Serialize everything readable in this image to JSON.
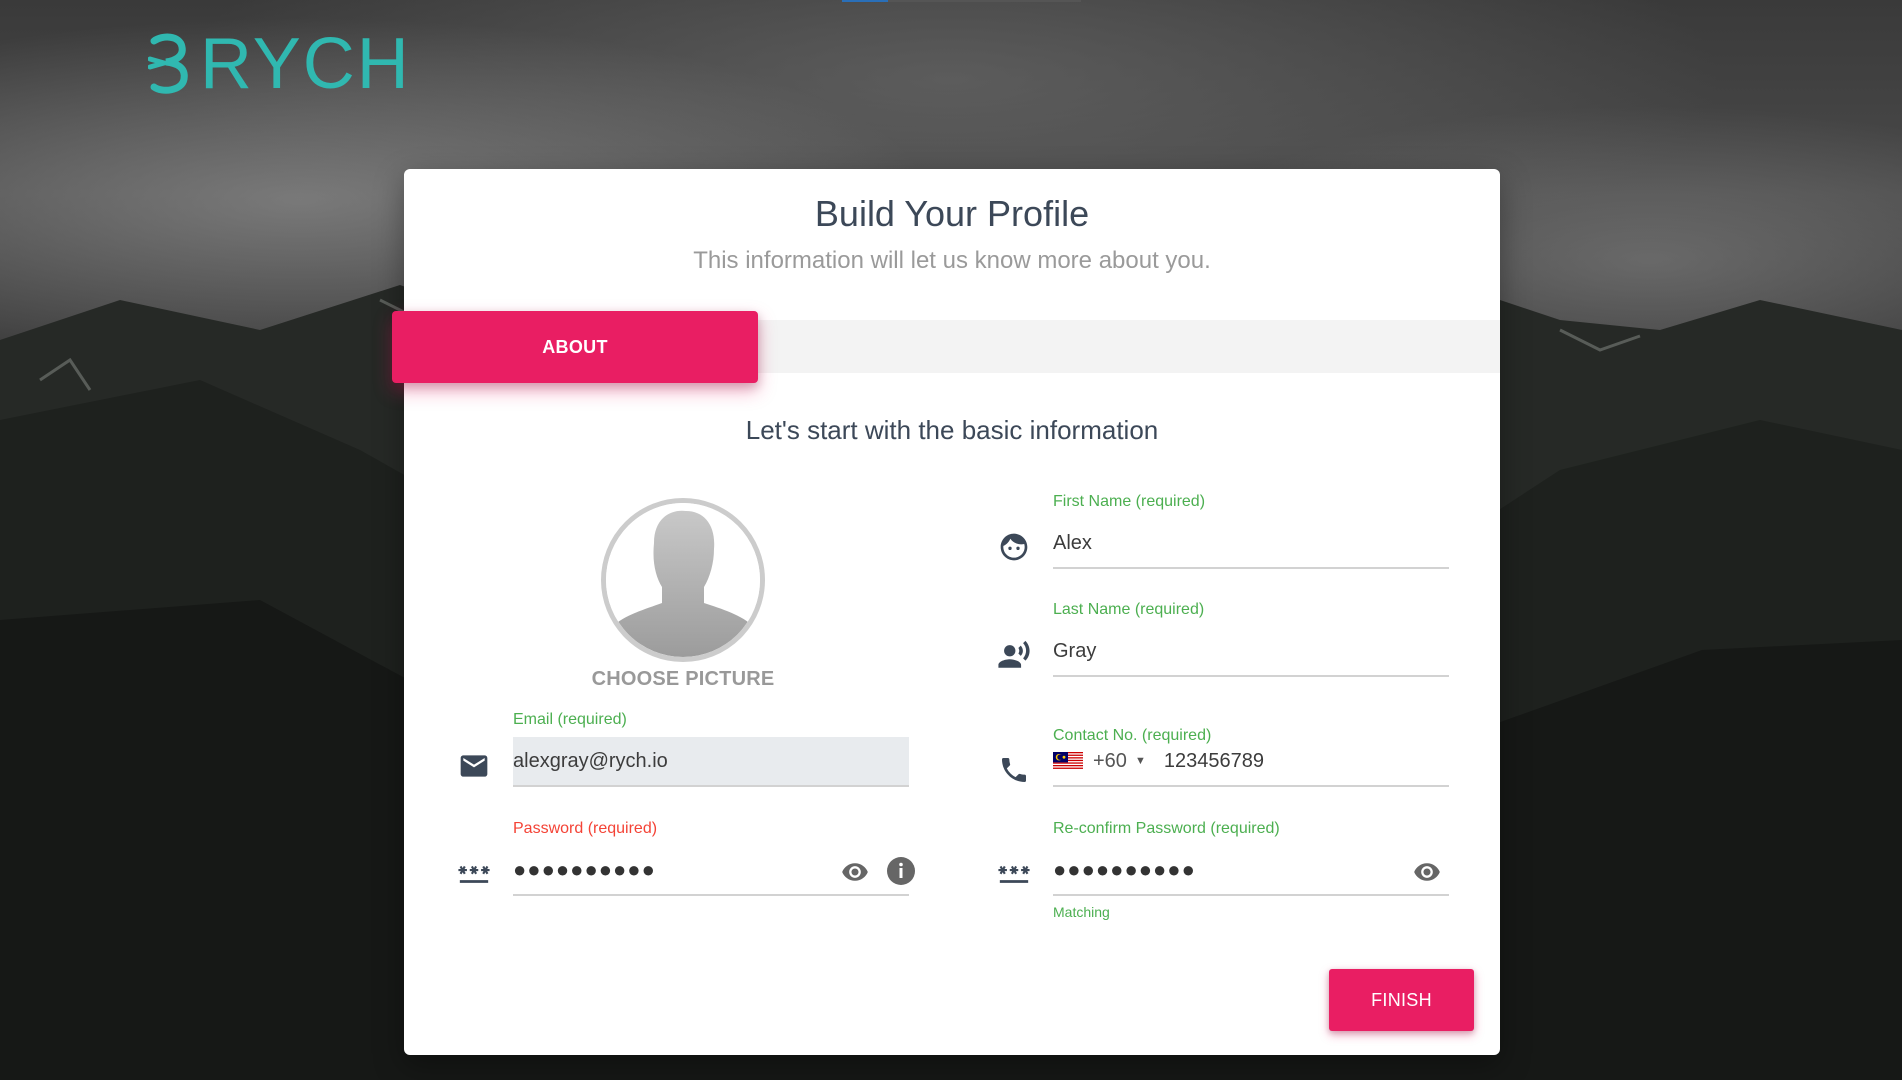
{
  "brand": {
    "name": "RYCH",
    "color": "#30b8b0"
  },
  "card": {
    "title": "Build Your Profile",
    "subtitle": "This information will let us know more about you."
  },
  "tabs": [
    {
      "label": "ABOUT",
      "active": true
    }
  ],
  "section": {
    "heading": "Let's start with the basic information"
  },
  "avatar": {
    "choose_label": "CHOOSE PICTURE",
    "icon": "user-silhouette"
  },
  "fields": {
    "first_name": {
      "label": "First Name (required)",
      "value": "Alex",
      "icon": "face-icon"
    },
    "last_name": {
      "label": "Last Name (required)",
      "value": "Gray",
      "icon": "record-voice-icon"
    },
    "email": {
      "label": "Email (required)",
      "value": "alexgray@rych.io",
      "icon": "email-icon"
    },
    "contact": {
      "label": "Contact No. (required)",
      "country_code": "+60",
      "value": "123456789",
      "icon": "phone-icon",
      "flag": "Malaysia"
    },
    "password": {
      "label": "Password (required)",
      "value": "●●●●●●●●●●",
      "icon": "password-icon",
      "label_color": "#f44336"
    },
    "confirm_password": {
      "label": "Re-confirm Password (required)",
      "value": "●●●●●●●●●●",
      "icon": "password-icon",
      "helper": "Matching"
    }
  },
  "actions": {
    "finish_label": "FINISH"
  },
  "colors": {
    "accent": "#e91e63",
    "success": "#4caf50",
    "error": "#f44336"
  }
}
